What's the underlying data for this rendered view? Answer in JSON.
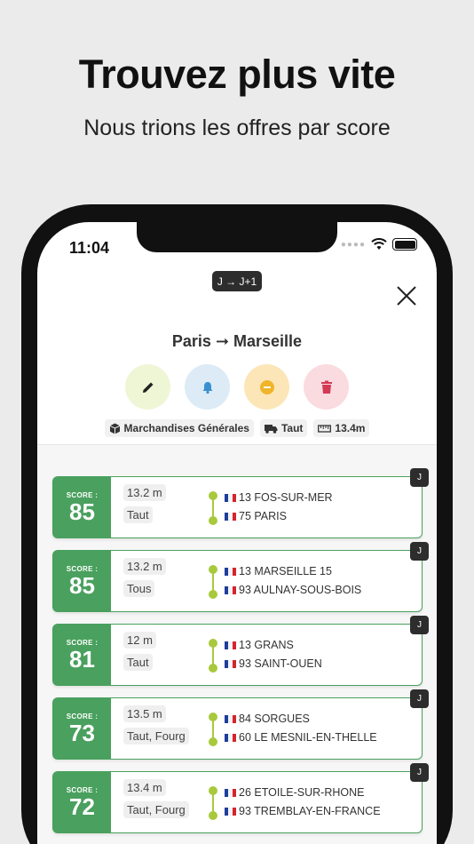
{
  "promo": {
    "headline": "Trouvez plus vite",
    "subline": "Nous trions les offres par score"
  },
  "status_bar": {
    "time": "11:04"
  },
  "header": {
    "date_badge": "J → J+1",
    "route_title": "Paris ➞ Marseille"
  },
  "actions": [
    {
      "name": "edit",
      "icon": "pencil-icon",
      "color": "#eff6d6"
    },
    {
      "name": "alert",
      "icon": "bell-icon",
      "color": "#dcebf5"
    },
    {
      "name": "pause",
      "icon": "minus-circle-icon",
      "color": "#fce6b8"
    },
    {
      "name": "delete",
      "icon": "trash-icon",
      "color": "#fadbe0"
    }
  ],
  "filters": {
    "goods": "Marchandises Générales",
    "vehicle": "Taut",
    "length": "13.4m"
  },
  "score_label": "SCORE :",
  "offers": [
    {
      "score": "85",
      "length": "13.2 m",
      "vehicle": "Taut",
      "from": "13 FOS-SUR-MER",
      "to": "75 PARIS",
      "tag": "J"
    },
    {
      "score": "85",
      "length": "13.2 m",
      "vehicle": "Tous",
      "from": "13 MARSEILLE 15",
      "to": "93 AULNAY-SOUS-BOIS",
      "tag": "J"
    },
    {
      "score": "81",
      "length": "12 m",
      "vehicle": "Taut",
      "from": "13 GRANS",
      "to": "93 SAINT-OUEN",
      "tag": "J"
    },
    {
      "score": "73",
      "length": "13.5 m",
      "vehicle": "Taut, Fourg",
      "from": "84 SORGUES",
      "to": "60 LE MESNIL-EN-THELLE",
      "tag": "J"
    },
    {
      "score": "72",
      "length": "13.4 m",
      "vehicle": "Taut, Fourg",
      "from": "26 ETOILE-SUR-RHONE",
      "to": "93 TREMBLAY-EN-FRANCE",
      "tag": "J"
    }
  ],
  "colors": {
    "score_green": "#4aa05e",
    "route_dot": "#a8c93c",
    "dark_badge": "#2d2d2d"
  }
}
